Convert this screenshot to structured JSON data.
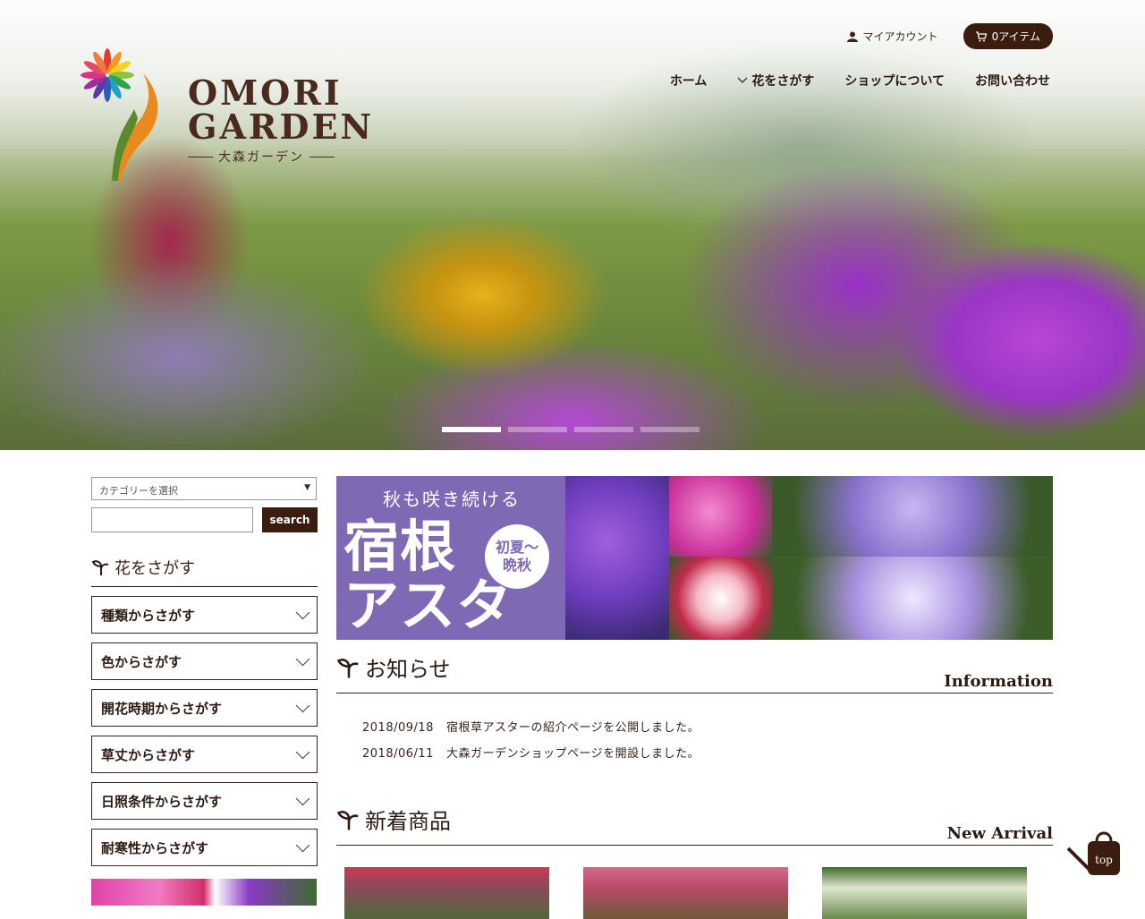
{
  "brand": {
    "line1": "OMORI",
    "line2": "GARDEN",
    "line3": "大森ガーデン"
  },
  "header": {
    "account_label": "マイアカウント",
    "cart_label": "0アイテム"
  },
  "nav": {
    "home": "ホーム",
    "find": "花をさがす",
    "about": "ショップについて",
    "contact": "お問い合わせ"
  },
  "sidebar": {
    "category_placeholder": "カテゴリーを選択",
    "search_button": "search",
    "section_title": "花をさがす",
    "categories": [
      "種類からさがす",
      "色からさがす",
      "開花時期からさがす",
      "草丈からさがす",
      "日照条件からさがす",
      "耐寒性からさがす"
    ]
  },
  "banner": {
    "subtitle": "秋も咲き続ける",
    "title_line1": "宿根",
    "title_line2": "アスター",
    "badge_line1": "初夏〜",
    "badge_line2": "晩秋"
  },
  "news": {
    "title": "お知らせ",
    "title_en": "Information",
    "items": [
      {
        "date": "2018/09/18",
        "text": "宿根草アスターの紹介ページを公開しました。"
      },
      {
        "date": "2018/06/11",
        "text": "大森ガーデンショップページを開設しました。"
      }
    ]
  },
  "new_arrival": {
    "title": "新着商品",
    "title_en": "New Arrival"
  },
  "top_button": "top",
  "slider": {
    "active_index": 0,
    "count": 4
  },
  "colors": {
    "brand_brown": "#3b1d10",
    "banner_purple": "#7f68b4"
  }
}
